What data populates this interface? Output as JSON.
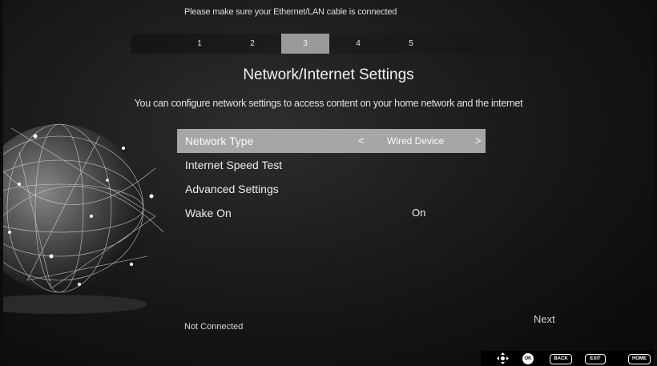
{
  "notice": "Please make sure your Ethernet/LAN cable is connected",
  "steps": [
    "1",
    "2",
    "3",
    "4",
    "5"
  ],
  "active_step": "3",
  "title": "Network/Internet Settings",
  "subtitle": "You can configure network settings to access content on your home network and the internet",
  "menu": {
    "network_type": {
      "label": "Network Type",
      "prev": "<",
      "value": "Wired Device",
      "next": ">"
    },
    "speed_test": {
      "label": "Internet Speed Test"
    },
    "advanced": {
      "label": "Advanced Settings"
    },
    "wake_on": {
      "label": "Wake On",
      "value": "On"
    }
  },
  "status": "Not Connected",
  "next_label": "Next",
  "remote": {
    "dpad_icon": "dpad-icon",
    "ok": "OK",
    "back": "BACK",
    "exit": "EXIT",
    "home": "HOME"
  }
}
